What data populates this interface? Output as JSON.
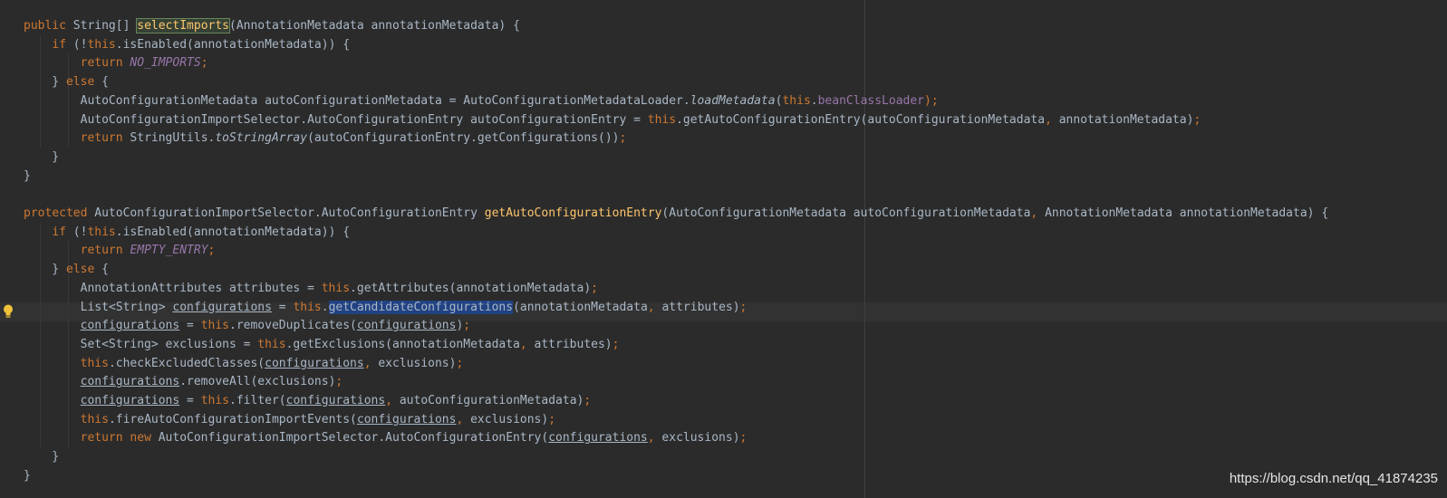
{
  "editor": {
    "colors": {
      "background": "#2b2b2b",
      "plain": "#a9b7c6",
      "keyword": "#cc7832",
      "method_declaration": "#ffc66d",
      "constant_field": "#9876aa",
      "usage_highlight": "#214283",
      "current_line": "#323232"
    },
    "gutter_icon": "intention-bulb-icon",
    "lines": [
      [
        [
          "public ",
          "kw"
        ],
        [
          "String[] ",
          "plain"
        ],
        [
          "selectImports",
          "hl-def"
        ],
        [
          "(AnnotationMetadata annotationMetadata) {",
          "plain"
        ]
      ],
      [
        [
          "    ",
          "plain"
        ],
        [
          "if ",
          "kw"
        ],
        [
          "(!",
          "plain"
        ],
        [
          "this",
          "kw"
        ],
        [
          ".isEnabled(annotationMetadata)) {",
          "plain"
        ]
      ],
      [
        [
          "        ",
          "plain"
        ],
        [
          "return ",
          "kw"
        ],
        [
          "NO_IMPORTS",
          "const"
        ],
        [
          ";",
          "punct"
        ]
      ],
      [
        [
          "    } ",
          "plain"
        ],
        [
          "else ",
          "kw"
        ],
        [
          "{",
          "plain"
        ]
      ],
      [
        [
          "        AutoConfigurationMetadata autoConfigurationMetadata = AutoConfigurationMetadataLoader.",
          "plain"
        ],
        [
          "loadMetadata",
          "static"
        ],
        [
          "(",
          "plain"
        ],
        [
          "this",
          "kw"
        ],
        [
          ".",
          "plain"
        ],
        [
          "beanClassLoader",
          "field"
        ],
        [
          ");",
          "punct"
        ]
      ],
      [
        [
          "        AutoConfigurationImportSelector.AutoConfigurationEntry autoConfigurationEntry = ",
          "plain"
        ],
        [
          "this",
          "kw"
        ],
        [
          ".getAutoConfigurationEntry(autoConfigurationMetadata",
          "plain"
        ],
        [
          ", ",
          "punct"
        ],
        [
          "annotationMetadata)",
          "plain"
        ],
        [
          ";",
          "punct"
        ]
      ],
      [
        [
          "        ",
          "plain"
        ],
        [
          "return ",
          "kw"
        ],
        [
          "StringUtils.",
          "plain"
        ],
        [
          "toStringArray",
          "static"
        ],
        [
          "(autoConfigurationEntry.getConfigurations())",
          "plain"
        ],
        [
          ";",
          "punct"
        ]
      ],
      [
        [
          "    }",
          "plain"
        ]
      ],
      [
        [
          "}",
          "plain"
        ]
      ],
      [],
      [
        [
          "protected ",
          "kw"
        ],
        [
          "AutoConfigurationImportSelector.AutoConfigurationEntry ",
          "plain"
        ],
        [
          "getAutoConfigurationEntry",
          "fn"
        ],
        [
          "(AutoConfigurationMetadata autoConfigurationMetadata",
          "plain"
        ],
        [
          ", ",
          "punct"
        ],
        [
          "AnnotationMetadata annotationMetadata) {",
          "plain"
        ]
      ],
      [
        [
          "    ",
          "plain"
        ],
        [
          "if ",
          "kw"
        ],
        [
          "(!",
          "plain"
        ],
        [
          "this",
          "kw"
        ],
        [
          ".isEnabled(annotationMetadata)) {",
          "plain"
        ]
      ],
      [
        [
          "        ",
          "plain"
        ],
        [
          "return ",
          "kw"
        ],
        [
          "EMPTY_ENTRY",
          "const"
        ],
        [
          ";",
          "punct"
        ]
      ],
      [
        [
          "    } ",
          "plain"
        ],
        [
          "else ",
          "kw"
        ],
        [
          "{",
          "plain"
        ]
      ],
      [
        [
          "        AnnotationAttributes attributes = ",
          "plain"
        ],
        [
          "this",
          "kw"
        ],
        [
          ".getAttributes(annotationMetadata)",
          "plain"
        ],
        [
          ";",
          "punct"
        ]
      ],
      [
        [
          "        List<String> ",
          "plain"
        ],
        [
          "configurations",
          "ul"
        ],
        [
          " = ",
          "plain"
        ],
        [
          "this",
          "kw"
        ],
        [
          ".",
          "plain"
        ],
        [
          "getCandidateConfigurations",
          "hl-usage"
        ],
        [
          "(annotationMetadata",
          "plain"
        ],
        [
          ", ",
          "punct"
        ],
        [
          "attributes)",
          "plain"
        ],
        [
          ";",
          "punct"
        ]
      ],
      [
        [
          "        ",
          "plain"
        ],
        [
          "configurations",
          "ul"
        ],
        [
          " = ",
          "plain"
        ],
        [
          "this",
          "kw"
        ],
        [
          ".removeDuplicates(",
          "plain"
        ],
        [
          "configurations",
          "ul"
        ],
        [
          ")",
          "plain"
        ],
        [
          ";",
          "punct"
        ]
      ],
      [
        [
          "        Set<String> exclusions = ",
          "plain"
        ],
        [
          "this",
          "kw"
        ],
        [
          ".getExclusions(annotationMetadata",
          "plain"
        ],
        [
          ", ",
          "punct"
        ],
        [
          "attributes)",
          "plain"
        ],
        [
          ";",
          "punct"
        ]
      ],
      [
        [
          "        ",
          "plain"
        ],
        [
          "this",
          "kw"
        ],
        [
          ".checkExcludedClasses(",
          "plain"
        ],
        [
          "configurations",
          "ul"
        ],
        [
          ", ",
          "punct"
        ],
        [
          "exclusions)",
          "plain"
        ],
        [
          ";",
          "punct"
        ]
      ],
      [
        [
          "        ",
          "plain"
        ],
        [
          "configurations",
          "ul"
        ],
        [
          ".removeAll(exclusions)",
          "plain"
        ],
        [
          ";",
          "punct"
        ]
      ],
      [
        [
          "        ",
          "plain"
        ],
        [
          "configurations",
          "ul"
        ],
        [
          " = ",
          "plain"
        ],
        [
          "this",
          "kw"
        ],
        [
          ".filter(",
          "plain"
        ],
        [
          "configurations",
          "ul"
        ],
        [
          ", ",
          "punct"
        ],
        [
          "autoConfigurationMetadata)",
          "plain"
        ],
        [
          ";",
          "punct"
        ]
      ],
      [
        [
          "        ",
          "plain"
        ],
        [
          "this",
          "kw"
        ],
        [
          ".fireAutoConfigurationImportEvents(",
          "plain"
        ],
        [
          "configurations",
          "ul"
        ],
        [
          ", ",
          "punct"
        ],
        [
          "exclusions)",
          "plain"
        ],
        [
          ";",
          "punct"
        ]
      ],
      [
        [
          "        ",
          "plain"
        ],
        [
          "return new ",
          "kw"
        ],
        [
          "AutoConfigurationImportSelector.AutoConfigurationEntry(",
          "plain"
        ],
        [
          "configurations",
          "ul"
        ],
        [
          ", ",
          "punct"
        ],
        [
          "exclusions)",
          "plain"
        ],
        [
          ";",
          "punct"
        ]
      ],
      [
        [
          "    }",
          "plain"
        ]
      ],
      [
        [
          "}",
          "plain"
        ]
      ]
    ]
  },
  "watermark": "https://blog.csdn.net/qq_41874235"
}
